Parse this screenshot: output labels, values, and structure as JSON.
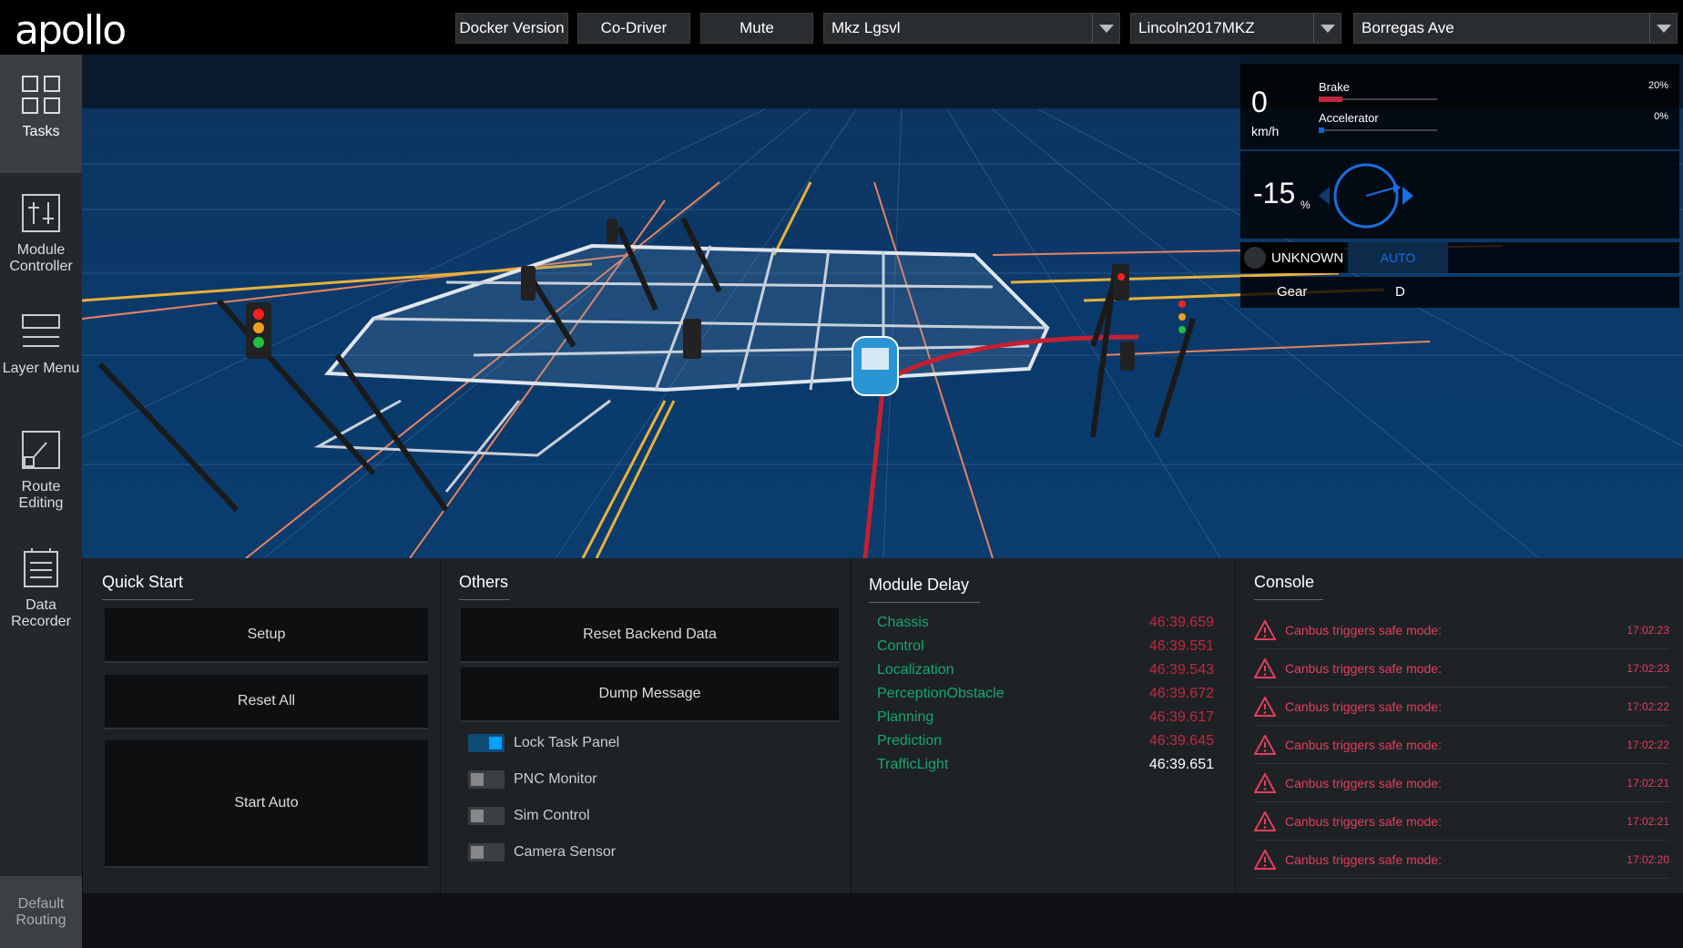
{
  "header": {
    "logo": "apollo",
    "buttons": [
      "Docker Version",
      "Co-Driver",
      "Mute"
    ],
    "selects": [
      "Mkz Lgsvl",
      "Lincoln2017MKZ",
      "Borregas Ave"
    ]
  },
  "sidebar": {
    "items": [
      {
        "label": "Tasks",
        "icon": "tasks-icon"
      },
      {
        "label": "Module Controller",
        "icon": "module-controller-icon"
      },
      {
        "label": "Layer Menu",
        "icon": "layer-menu-icon"
      },
      {
        "label": "Route Editing",
        "icon": "route-editing-icon"
      },
      {
        "label": "Data Recorder",
        "icon": "data-recorder-icon"
      }
    ],
    "default_routing": "Default Routing"
  },
  "dashboard": {
    "speed": "0",
    "speed_unit": "km/h",
    "brake_label": "Brake",
    "brake_value": "20%",
    "brake_level": 0.2,
    "accel_label": "Accelerator",
    "accel_value": "0%",
    "accel_level": 0.0,
    "steering_value": "-15",
    "steering_unit": "%",
    "mode_status": "UNKNOWN",
    "mode_auto": "AUTO",
    "gear_label": "Gear",
    "gear_value": "D"
  },
  "quick_start": {
    "title": "Quick Start",
    "buttons": [
      "Setup",
      "Reset All",
      "Start Auto"
    ]
  },
  "others": {
    "title": "Others",
    "buttons": [
      "Reset Backend Data",
      "Dump Message"
    ],
    "toggles": [
      {
        "label": "Lock Task Panel",
        "on": true
      },
      {
        "label": "PNC Monitor",
        "on": false
      },
      {
        "label": "Sim Control",
        "on": false
      },
      {
        "label": "Camera Sensor",
        "on": false
      }
    ]
  },
  "module_delay": {
    "title": "Module Delay",
    "rows": [
      {
        "name": "Chassis",
        "value": "46:39.659"
      },
      {
        "name": "Control",
        "value": "46:39.551"
      },
      {
        "name": "Localization",
        "value": "46:39.543"
      },
      {
        "name": "PerceptionObstacle",
        "value": "46:39.672"
      },
      {
        "name": "Planning",
        "value": "46:39.617"
      },
      {
        "name": "Prediction",
        "value": "46:39.645"
      },
      {
        "name": "TrafficLight",
        "value": "46:39.651"
      }
    ]
  },
  "console": {
    "title": "Console",
    "rows": [
      {
        "message": "Canbus triggers safe mode:",
        "time": "17:02:23"
      },
      {
        "message": "Canbus triggers safe mode:",
        "time": "17:02:23"
      },
      {
        "message": "Canbus triggers safe mode:",
        "time": "17:02:22"
      },
      {
        "message": "Canbus triggers safe mode:",
        "time": "17:02:22"
      },
      {
        "message": "Canbus triggers safe mode:",
        "time": "17:02:21"
      },
      {
        "message": "Canbus triggers safe mode:",
        "time": "17:02:21"
      },
      {
        "message": "Canbus triggers safe mode:",
        "time": "17:02:20"
      }
    ]
  },
  "colors": {
    "accent_blue": "#00a0ff",
    "delay_name": "#19a56f",
    "delay_value": "#c0283f",
    "console_error": "#e23e5e"
  }
}
